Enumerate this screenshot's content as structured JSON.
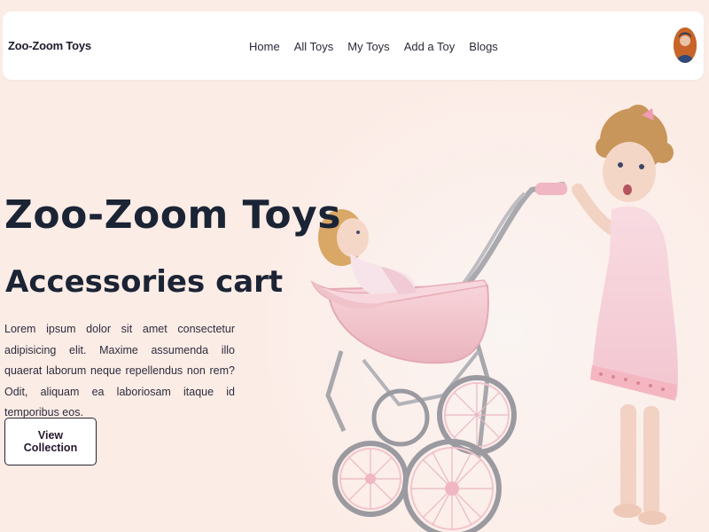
{
  "navbar": {
    "brand": "Zoo-Zoom Toys",
    "links": [
      {
        "label": "Home"
      },
      {
        "label": "All Toys"
      },
      {
        "label": "My Toys"
      },
      {
        "label": "Add a Toy"
      },
      {
        "label": "Blogs"
      }
    ]
  },
  "hero": {
    "title": "Zoo-Zoom Toys",
    "subtitle": "Accessories cart",
    "description": "Lorem ipsum dolor sit amet consectetur adipisicing elit. Maxime assumenda illo quaerat laborum neque repellendus non rem? Odit, aliquam ea laboriosam itaque id temporibus eos.",
    "cta_label": "View Collection"
  },
  "colors": {
    "page_background": "#fcece6",
    "navbar_background": "#ffffff",
    "heading_text": "#1b2434",
    "pram_pink": "#f3c9cf"
  },
  "icons": {
    "avatar": "user-avatar-photo"
  }
}
